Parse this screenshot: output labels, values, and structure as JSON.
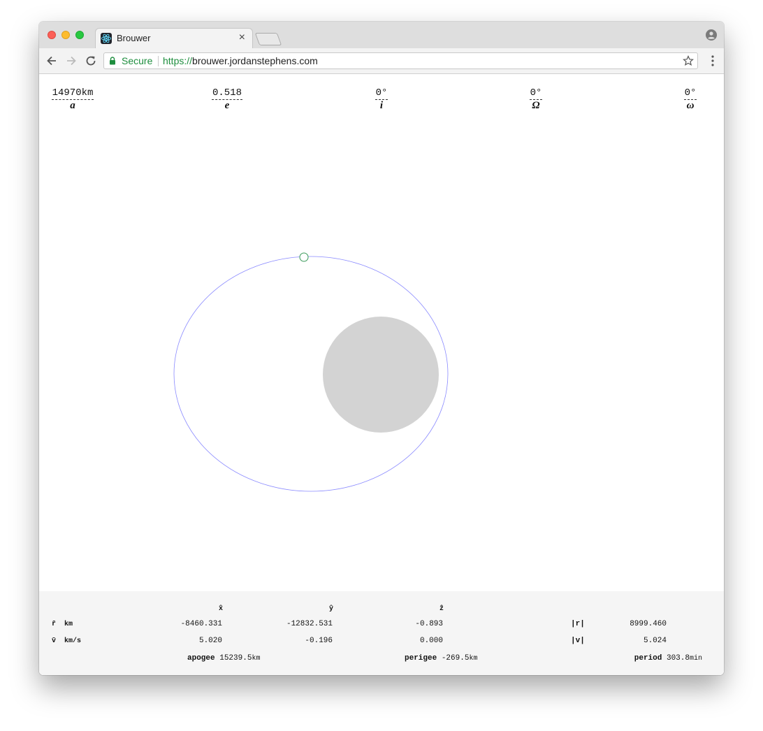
{
  "browser": {
    "tab_title": "Brouwer",
    "tab_close": "×",
    "secure_label": "Secure",
    "url_scheme": "https://",
    "url_host": "brouwer.jordanstephens.com"
  },
  "orbital_elements": [
    {
      "value": "14970km",
      "symbol": "a"
    },
    {
      "value": "0.518",
      "symbol": "e"
    },
    {
      "value": "0°",
      "symbol": "i"
    },
    {
      "value": "0°",
      "symbol": "Ω"
    },
    {
      "value": "0°",
      "symbol": "ω"
    }
  ],
  "state": {
    "axes": {
      "x": "x̂",
      "y": "ŷ",
      "z": "ẑ"
    },
    "r": {
      "label": "r̄",
      "unit": "km",
      "x": "-8460.331",
      "y": "-12832.531",
      "z": "-0.893",
      "mag_label": "|r|",
      "mag": "8999.460"
    },
    "v": {
      "label": "v̄",
      "unit": "km/s",
      "x": "5.020",
      "y": "-0.196",
      "z": "0.000",
      "mag_label": "|v|",
      "mag": "5.024"
    }
  },
  "summary": {
    "apogee_label": "apogee",
    "apogee_value": "15239.5",
    "apogee_unit": "km",
    "perigee_label": "perigee",
    "perigee_value": "-269.5",
    "perigee_unit": "km",
    "period_label": "period",
    "period_value": "303.8",
    "period_unit": "min"
  },
  "colors": {
    "orbit": "#8a8aff",
    "planet": "#d3d3d3",
    "satellite": "#3a9a5a"
  }
}
